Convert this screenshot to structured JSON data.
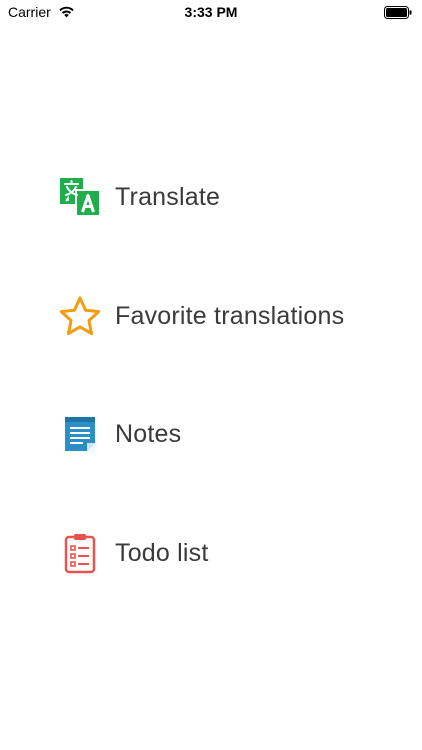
{
  "status_bar": {
    "carrier": "Carrier",
    "time": "3:33 PM",
    "wifi_icon": "wifi-icon",
    "battery_icon": "battery-full-icon"
  },
  "menu": {
    "items": [
      {
        "label": "Translate",
        "icon": "translate-icon",
        "color": "#1fae4b"
      },
      {
        "label": "Favorite translations",
        "icon": "star-outline-icon",
        "color": "#f39c12"
      },
      {
        "label": "Notes",
        "icon": "notes-icon",
        "color": "#2a8fc7"
      },
      {
        "label": "Todo list",
        "icon": "clipboard-checklist-icon",
        "color": "#e8524f"
      }
    ]
  }
}
